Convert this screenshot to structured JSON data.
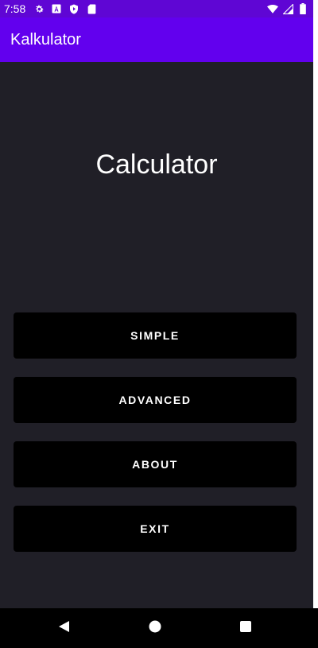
{
  "status_bar": {
    "time": "7:58",
    "left_icons": [
      "gear-icon",
      "a-letter-icon",
      "shield-icon",
      "sd-card-icon"
    ],
    "right_icons": [
      "wifi-icon",
      "signal-icon",
      "battery-icon"
    ],
    "color": "#5f06d4"
  },
  "app_bar": {
    "title": "Kalkulator",
    "color": "#6200ee"
  },
  "main": {
    "heading": "Calculator",
    "background": "#201f27",
    "buttons": {
      "simple": "SIMPLE",
      "advanced": "ADVANCED",
      "about": "ABOUT",
      "exit": "EXIT"
    }
  },
  "nav_bar": {
    "icons": [
      "back-icon",
      "home-icon",
      "recent-apps-icon"
    ]
  }
}
